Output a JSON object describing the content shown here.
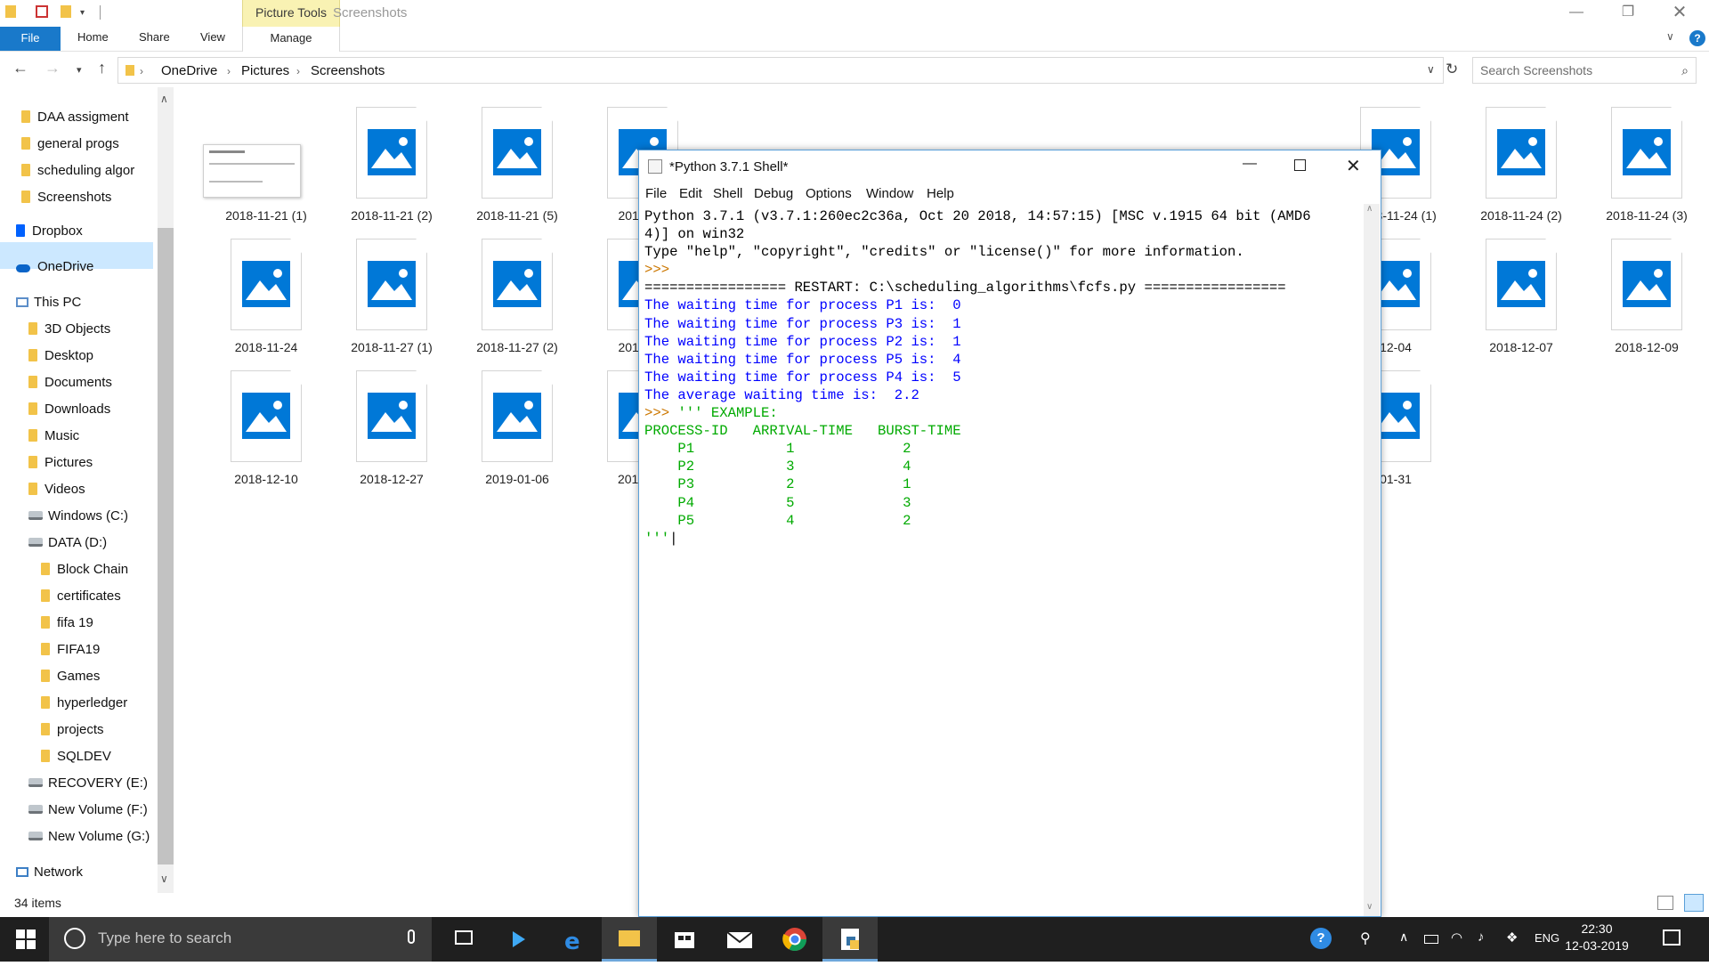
{
  "explorer": {
    "context_tab": "Picture Tools",
    "window_title": "Screenshots",
    "ribbon_tabs": [
      "File",
      "Home",
      "Share",
      "View",
      "Manage"
    ],
    "breadcrumb": [
      "OneDrive",
      "Pictures",
      "Screenshots"
    ],
    "search_placeholder": "Search Screenshots",
    "nav_items": [
      "DAA assigment",
      "general progs",
      "scheduling algor",
      "Screenshots",
      "Dropbox",
      "OneDrive",
      "This PC",
      "3D Objects",
      "Desktop",
      "Documents",
      "Downloads",
      "Music",
      "Pictures",
      "Videos",
      "Windows (C:)",
      "DATA (D:)",
      "Block Chain",
      "certificates",
      "fifa 19",
      "FIFA19",
      "Games",
      "hyperledger",
      "projects",
      "SQLDEV",
      "RECOVERY (E:)",
      "New Volume (F:)",
      "New Volume (G:)",
      "Network"
    ],
    "item_count": "34 items",
    "thumbnails": [
      "2018-11-21 (1)",
      "2018-11-21 (2)",
      "2018-11-21 (5)",
      "2018-11-",
      "2018-11-24 (1)",
      "2018-11-24 (2)",
      "2018-11-24 (3)",
      "2018-11-24",
      "2018-11-27 (1)",
      "2018-11-27 (2)",
      "2018-11-",
      "12-04",
      "2018-12-07",
      "2018-12-09",
      "2018-12-10",
      "2018-12-27",
      "2019-01-06",
      "2019-01-",
      "01-31"
    ]
  },
  "shell": {
    "title": "*Python 3.7.1 Shell*",
    "menu": [
      "File",
      "Edit",
      "Shell",
      "Debug",
      "Options",
      "Window",
      "Help"
    ],
    "lines": [
      "Python 3.7.1 (v3.7.1:260ec2c36a, Oct 20 2018, 14:57:15) [MSC v.1915 64 bit (AMD6",
      "4)] on win32",
      "Type \"help\", \"copyright\", \"credits\" or \"license()\" for more information.",
      ">>> ",
      "================= RESTART: C:\\scheduling_algorithms\\fcfs.py =================",
      "The waiting time for process P1 is:  0",
      "The waiting time for process P3 is:  1",
      "The waiting time for process P2 is:  1",
      "The waiting time for process P5 is:  4",
      "The waiting time for process P4 is:  5",
      "The average waiting time is:  2.2",
      "''' EXAMPLE:",
      "PROCESS-ID   ARRIVAL-TIME   BURST-TIME",
      "    P1           1             2",
      "    P2           3             4",
      "    P3           2             1",
      "",
      "    P4           5             3",
      "",
      "    P5           4             2",
      "'''"
    ],
    "prompt": ">>> "
  },
  "taskbar": {
    "search_placeholder": "Type here to search",
    "lang": "ENG",
    "time": "22:30",
    "date": "12-03-2019"
  },
  "colors": {
    "accent": "#0078d7",
    "file_tab": "#1979ca",
    "context_tab": "#f9f2b3",
    "idle_output": "#0000ff",
    "idle_string": "#00aa00",
    "idle_prompt": "#cc7700"
  }
}
